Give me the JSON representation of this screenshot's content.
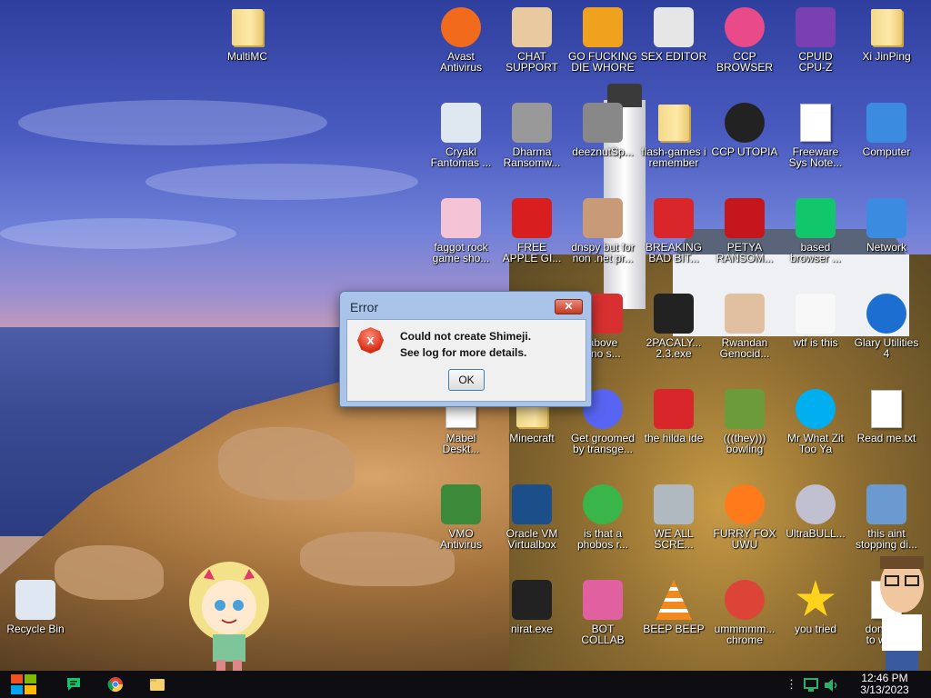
{
  "desktop": {
    "icons": [
      {
        "label": "MultiMC",
        "icon": "folder-icon"
      },
      {
        "label": "Avast\nAntivirus",
        "icon": "avast-icon"
      },
      {
        "label": "CHAT\nSUPPORT",
        "icon": "doctor-icon"
      },
      {
        "label": "GO FUCKING\nDIE WHORE",
        "icon": "de-icon"
      },
      {
        "label": "SEX EDITOR",
        "icon": "hxd-icon"
      },
      {
        "label": "CCP\nBROWSER",
        "icon": "browser-icon"
      },
      {
        "label": "CPUID\nCPU-Z",
        "icon": "cpuz-icon"
      },
      {
        "label": "Xi JinPing",
        "icon": "user-folder-icon"
      },
      {
        "label": "Cryakl\nFantomas ...",
        "icon": "app-window-icon"
      },
      {
        "label": "Dharma\nRansomw...",
        "icon": "skull-gear-icon"
      },
      {
        "label": "deeznutSp...",
        "icon": "stacked-windows-icon"
      },
      {
        "label": "flash-games i\nremember",
        "icon": "folder-icon"
      },
      {
        "label": "CCP UTOPIA",
        "icon": "red-circle-icon"
      },
      {
        "label": "Freeware\nSys Note...",
        "icon": "document-icon"
      },
      {
        "label": "Computer",
        "icon": "computer-icon"
      },
      {
        "label": "faggot rock\ngame sho...",
        "icon": "pig-icon"
      },
      {
        "label": "FREE\nAPPLE GI...",
        "icon": "apple-icon"
      },
      {
        "label": "dnspy but for\nnon .net pr...",
        "icon": "portrait-icon"
      },
      {
        "label": "BREAKING\nBAD BIT...",
        "icon": "angry-bird-icon"
      },
      {
        "label": "PETYA\nRANSOM...",
        "icon": "skull-red-icon"
      },
      {
        "label": "based\nbrowser ...",
        "icon": "chat-icon"
      },
      {
        "label": "Network",
        "icon": "network-icon"
      },
      {
        "label": "above\n: no s...",
        "icon": "number-icon"
      },
      {
        "label": "2PACALY...\n2.3.exe",
        "icon": "terminal-icon"
      },
      {
        "label": "Rwandan\nGenocid...",
        "icon": "meme-icon"
      },
      {
        "label": "wtf is this",
        "icon": "calendar-icon"
      },
      {
        "label": "Glary Utilities\n4",
        "icon": "glary-icon"
      },
      {
        "label": "Mabel\nDeskt...",
        "icon": "document-icon"
      },
      {
        "label": "Minecraft",
        "icon": "folder-icon"
      },
      {
        "label": "Get groomed\nby transge...",
        "icon": "discord-icon"
      },
      {
        "label": "the hilda ide",
        "icon": "devcpp-icon"
      },
      {
        "label": "(((they)))\nbowling",
        "icon": "bowling-icon"
      },
      {
        "label": "Mr What Zit\nToo Ya",
        "icon": "skype-icon"
      },
      {
        "label": "Read me.txt",
        "icon": "text-file-icon"
      },
      {
        "label": "VMO\nAntivirus",
        "icon": "shield-icon"
      },
      {
        "label": "Oracle VM\nVirtualbox",
        "icon": "virtualbox-icon"
      },
      {
        "label": "is that a\nphobos r...",
        "icon": "icq-icon"
      },
      {
        "label": "WE ALL\nSCRE...",
        "icon": "old-computer-icon"
      },
      {
        "label": "FURRY FOX\nUWU",
        "icon": "firefox-icon"
      },
      {
        "label": "UltraBULL...",
        "icon": "disc-icon"
      },
      {
        "label": "this aint\nstopping di...",
        "icon": "network-computer-icon"
      },
      {
        "label": "Recycle Bin",
        "icon": "recycle-bin-icon"
      },
      {
        "label": "nirat.exe",
        "icon": "skull-icon"
      },
      {
        "label": "BOT\nCOLLAB",
        "icon": "monitor-pink-icon"
      },
      {
        "label": "BEEP BEEP",
        "icon": "vlc-icon"
      },
      {
        "label": "ummmmm...\nchrome",
        "icon": "chrome-icon"
      },
      {
        "label": "you tried",
        "icon": "star-icon"
      },
      {
        "label": "dont fo...\nto was...",
        "icon": "document-icon"
      }
    ]
  },
  "dialog": {
    "title": "Error",
    "close_label": "✕",
    "message_line1": "Could not create Shimeji.",
    "message_line2": "See log for more details.",
    "ok_label": "OK"
  },
  "taskbar": {
    "time": "12:46 PM",
    "date": "3/13/2023"
  }
}
